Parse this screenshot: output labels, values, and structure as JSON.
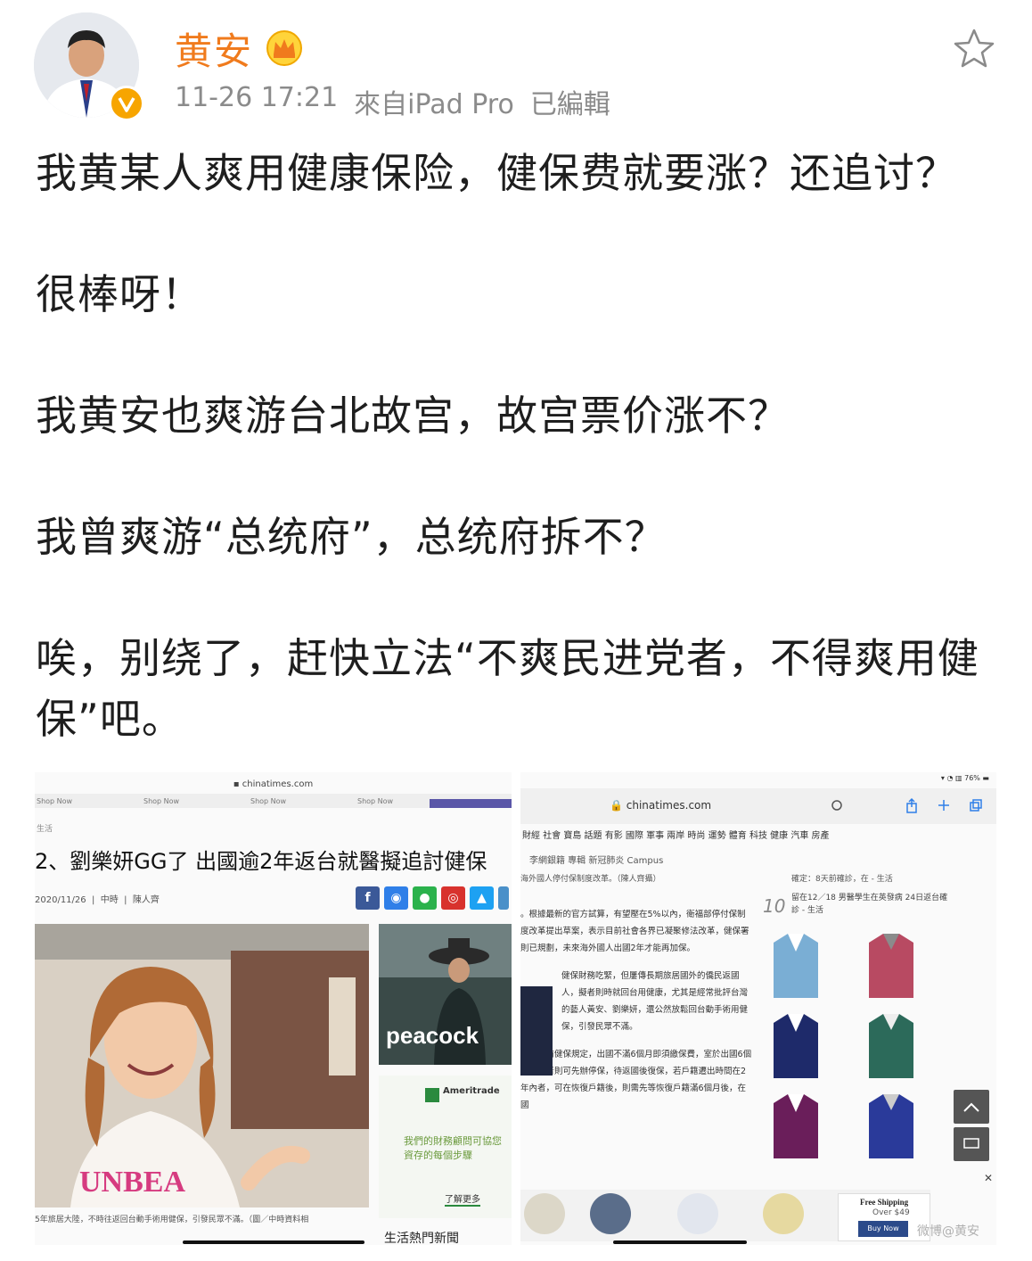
{
  "header": {
    "username": "黄安",
    "timestamp": "11-26 17:21",
    "source": "來自iPad Pro",
    "edited": "已編輯"
  },
  "post": {
    "paragraphs": [
      "我黄某人爽用健康保险，健保费就要涨？还追讨？",
      "很棒呀！",
      "我黄安也爽游台北故宫，故宫票价涨不？",
      "我曾爽游“总统府”，总统府拆不？",
      "唉，别绕了，赶快立法“不爽民进党者，不得爽用健保”吧。"
    ]
  },
  "image_left": {
    "url": "chinatimes.com",
    "nav_items": [
      "Shop Now",
      "Shop Now",
      "Shop Now",
      "Shop Now"
    ],
    "section": "生活",
    "headline": "2、劉樂妍GG了 出國逾2年返台就醫擬追討健保",
    "date": "2020/11/26",
    "source": "中時",
    "author": "陳人齊",
    "ad_brand": "peacock",
    "ad2_brand": "Ameritrade",
    "ad2_text": "我們的財務顧問可協您資存的每個步驟",
    "ad2_more": "了解更多",
    "caption": "5年旅居大陸，不時往返回台動手術用健保，引發民眾不滿。（圖／中時資料相",
    "hot_news": "生活熱門新聞"
  },
  "image_right": {
    "status": "76%",
    "url": "chinatimes.com",
    "categories": "財經 社會 寶島 話題 有影 國際 軍事 兩岸 時尚 運勢 體育 科技 健康 汽車 房產",
    "categories2": "李網銀籍  專輯  新冠肺炎  Campus",
    "subtitle": "海外國人停付保制度改革。（陳人齊攝）",
    "article": [
      "。根據最新的官方試算，有望壓在5%以內，衛福部停付保制度改革提出草案，表示目前社會各界已凝聚修法改革，健保署則已規劃，未來海外國人出國2年才能再加保。",
      "健保財務吃緊，但屢傳長期旅居國外的僑民返國人，擬者則時就回台用健康，尤其是經常批評台灣的藝人黃安、劉樂妍，還公然放鬆回台動手術用健保，引發民眾不滿。",
      "依照目前健保規定，出國不滿6個月即須繳保費，室於出國6個月以上者則可先辦停保，待返國後復保，若戶籍遷出時間在2年內者，可在恢復戶籍後，則需先等恢復戶籍滿6個月後，在國"
    ],
    "rank_number": "10",
    "rank_text": "留在12／18 男醫學生在英發病 24日返台確診 - 生活",
    "rank_prev": "確定：8天前確診，在 - 生活",
    "ship_title": "Free Shipping",
    "ship_sub": "Over $49",
    "buy_now": "Buy Now",
    "watermark": "微博@黄安"
  }
}
